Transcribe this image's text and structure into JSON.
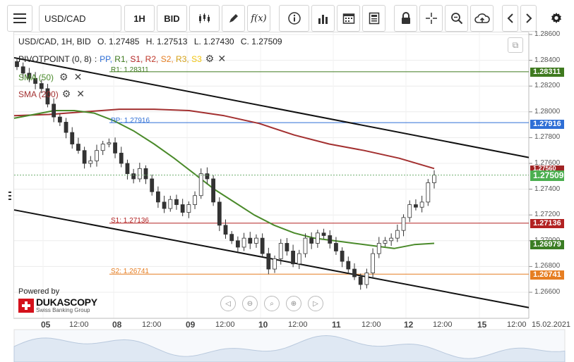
{
  "toolbar": {
    "symbol": "USD/CAD",
    "timeframe": "1H",
    "price_type": "BID",
    "fx_label": "f(x)"
  },
  "chart_info": {
    "symbol_line": "USD/CAD, 1H, BID",
    "open": "O. 1.27485",
    "high": "H. 1.27513",
    "low": "L. 1.27430",
    "close": "C. 1.27509"
  },
  "indicators": {
    "pivot": {
      "name": "PIVOTPOINT (0, 8)",
      "sep": ":",
      "items": [
        {
          "label": "PP,",
          "color": "#2f6fd6"
        },
        {
          "label": "R1,",
          "color": "#3f7a1f"
        },
        {
          "label": "S1,",
          "color": "#b22222"
        },
        {
          "label": "R2,",
          "color": "#c0392b"
        },
        {
          "label": "S2,",
          "color": "#e67e22"
        },
        {
          "label": "R3,",
          "color": "#d4a017"
        },
        {
          "label": "S3",
          "color": "#f1c40f"
        }
      ]
    },
    "sma50": {
      "name": "SMA (50)",
      "color": "#4a8a2a"
    },
    "sma200": {
      "name": "SMA (200)",
      "color": "#a33030"
    }
  },
  "levels": {
    "r1": {
      "label": "R1: 1.28311",
      "tag": "1.28311",
      "color": "#3f7a1f"
    },
    "pp": {
      "label": "PP: 1.27916",
      "tag": "1.27916",
      "color": "#2f6fd6"
    },
    "s1": {
      "label": "S1: 1.27136",
      "tag": "1.27136",
      "color": "#b22222"
    },
    "s2": {
      "label": "S2: 1.26741",
      "tag": "1.26741",
      "color": "#e67e22"
    }
  },
  "price_tags": {
    "sma200": {
      "value": "1.27560",
      "color": "#a02424"
    },
    "last": {
      "value": "1.27509",
      "color": "#4caf50"
    },
    "sma50": {
      "value": "1.26979",
      "color": "#3b7d24"
    }
  },
  "price_axis": [
    "1.28600",
    "1.28400",
    "1.28200",
    "1.28000",
    "1.27800",
    "1.27600",
    "1.27400",
    "1.27200",
    "1.27000",
    "1.26800",
    "1.26600"
  ],
  "time_axis": [
    {
      "label": "05",
      "bold": true
    },
    {
      "label": "12:00",
      "bold": false
    },
    {
      "label": "08",
      "bold": true
    },
    {
      "label": "12:00",
      "bold": false
    },
    {
      "label": "09",
      "bold": true
    },
    {
      "label": "12:00",
      "bold": false
    },
    {
      "label": "10",
      "bold": true
    },
    {
      "label": "12:00",
      "bold": false
    },
    {
      "label": "11",
      "bold": true
    },
    {
      "label": "12:00",
      "bold": false
    },
    {
      "label": "12",
      "bold": true
    },
    {
      "label": "12:00",
      "bold": false
    },
    {
      "label": "15",
      "bold": true
    },
    {
      "label": "12:00",
      "bold": false
    },
    {
      "label": "15.02.2021",
      "bold": false
    }
  ],
  "branding": {
    "powered_by": "Powered by",
    "name": "DUKASCOPY",
    "tagline": "Swiss Banking Group"
  },
  "chart_data": {
    "type": "candlestick",
    "symbol": "USD/CAD",
    "interval": "1H",
    "ylim": [
      1.265,
      1.287
    ],
    "last_price": 1.27509,
    "levels": {
      "R1": 1.28311,
      "PP": 1.27916,
      "S1": 1.27136,
      "S2": 1.26741
    },
    "sma50_last": 1.26979,
    "sma200_last": 1.2756,
    "close_path": [
      1.2835,
      1.283,
      1.2826,
      1.2822,
      1.2818,
      1.2806,
      1.2796,
      1.2792,
      1.2784,
      1.2775,
      1.277,
      1.276,
      1.2762,
      1.277,
      1.2775,
      1.2776,
      1.2768,
      1.276,
      1.2752,
      1.2748,
      1.2756,
      1.2748,
      1.2738,
      1.273,
      1.2725,
      1.2732,
      1.2728,
      1.2722,
      1.2728,
      1.2735,
      1.2752,
      1.2748,
      1.273,
      1.2712,
      1.2705,
      1.27,
      1.2695,
      1.2702,
      1.2698,
      1.2702,
      1.269,
      1.2678,
      1.2686,
      1.2698,
      1.2692,
      1.2682,
      1.269,
      1.2702,
      1.2698,
      1.2706,
      1.2704,
      1.2698,
      1.2692,
      1.2684,
      1.2678,
      1.2672,
      1.2666,
      1.2675,
      1.269,
      1.2698,
      1.27,
      1.2702,
      1.2708,
      1.2718,
      1.2728,
      1.2726,
      1.273,
      1.2745,
      1.2751
    ],
    "sma50_path": [
      1.2795,
      1.2798,
      1.2801,
      1.2801,
      1.2799,
      1.2793,
      1.2785,
      1.2775,
      1.2764,
      1.2752,
      1.274,
      1.273,
      1.272,
      1.2712,
      1.2706,
      1.2702,
      1.27,
      1.2698,
      1.2696,
      1.2694,
      1.2697,
      1.2698
    ],
    "sma200_path": [
      1.2797,
      1.2798,
      1.28,
      1.2802,
      1.2802,
      1.2801,
      1.2797,
      1.2791,
      1.2782,
      1.2775,
      1.277,
      1.2764,
      1.2756
    ],
    "channel_upper": [
      [
        0,
        1.2842
      ],
      [
        1,
        1.27646
      ]
    ],
    "channel_lower": [
      [
        0,
        1.27239
      ],
      [
        1,
        1.26481
      ]
    ]
  }
}
